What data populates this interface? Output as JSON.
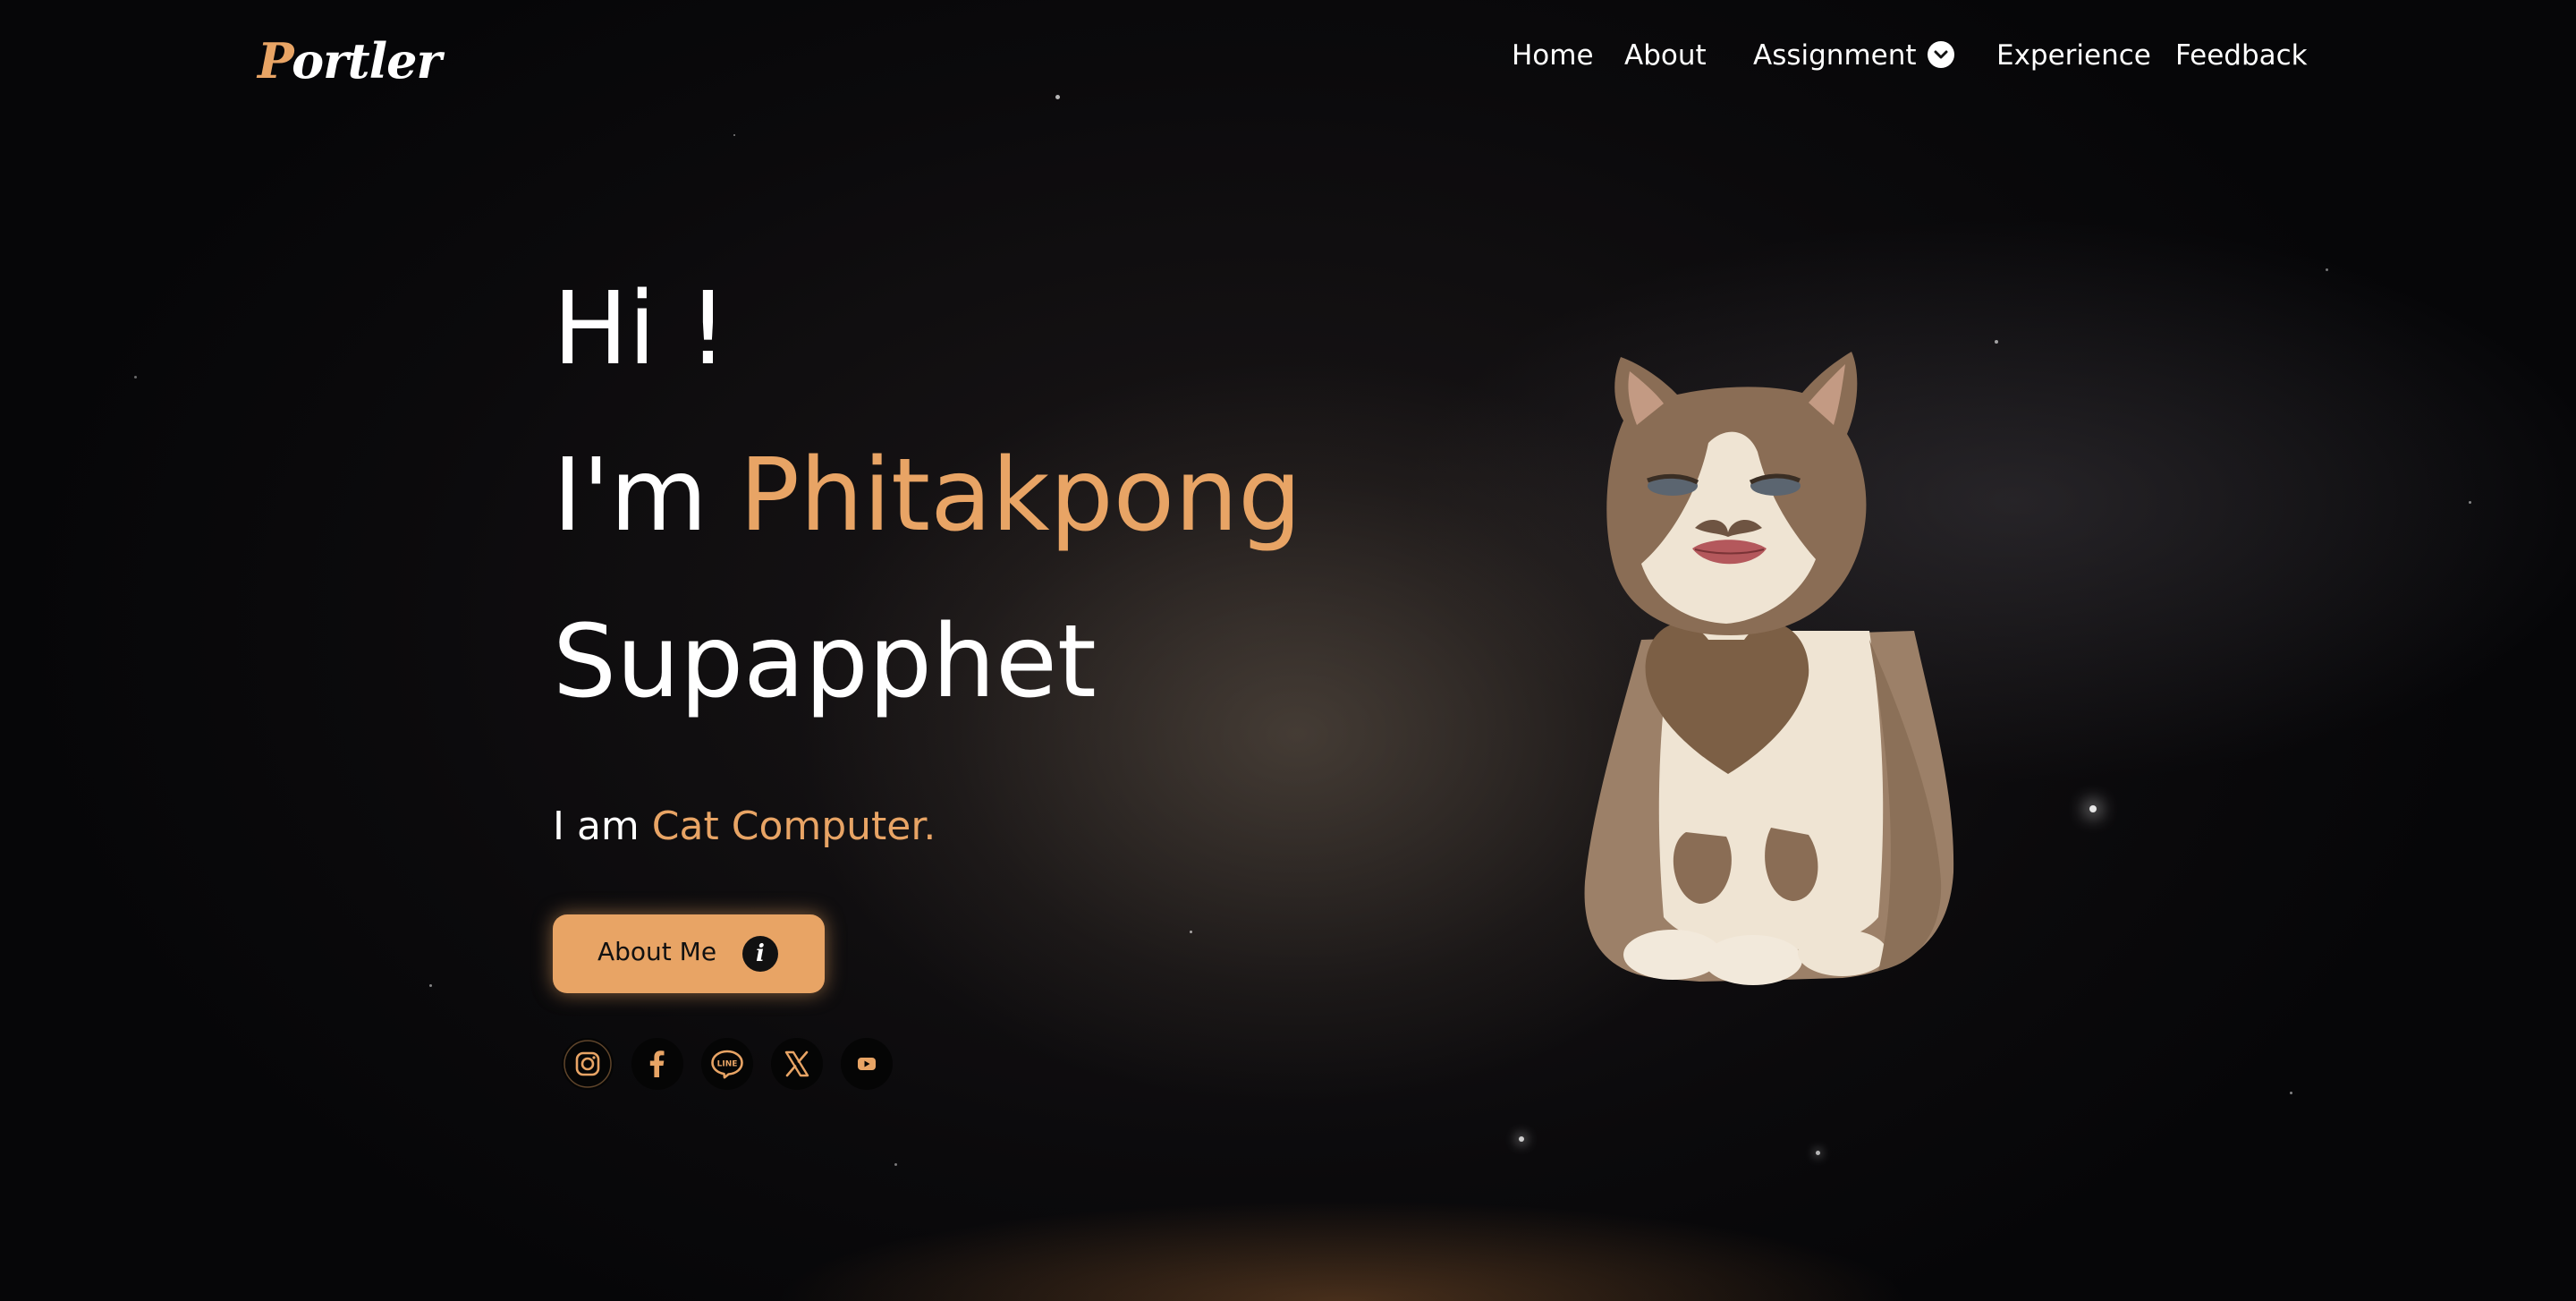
{
  "navbar": {
    "logo": {
      "first": "P",
      "rest": "ortler"
    },
    "links": {
      "home": "Home",
      "about": "About",
      "assignment": "Assignment",
      "experience": "Experience",
      "feedback": "Feedback"
    },
    "icons": {
      "assignment_dropdown": "chevron-down-icon"
    }
  },
  "hero": {
    "greeting": "Hi !",
    "intro_prefix": "I'm",
    "first_name": "Phitakpong",
    "last_name": "Supapphet",
    "tagline_prefix": "I am",
    "tagline_accent": "Cat Computer.",
    "about_button": "About Me",
    "about_button_icon": "info-icon"
  },
  "socials": [
    {
      "name": "instagram-icon"
    },
    {
      "name": "facebook-icon"
    },
    {
      "name": "line-icon",
      "text": "LINE"
    },
    {
      "name": "x-icon"
    },
    {
      "name": "youtube-icon"
    }
  ],
  "theme": {
    "accent": "#e8a465",
    "text": "#ffffff",
    "background": "#0b0a0c"
  }
}
